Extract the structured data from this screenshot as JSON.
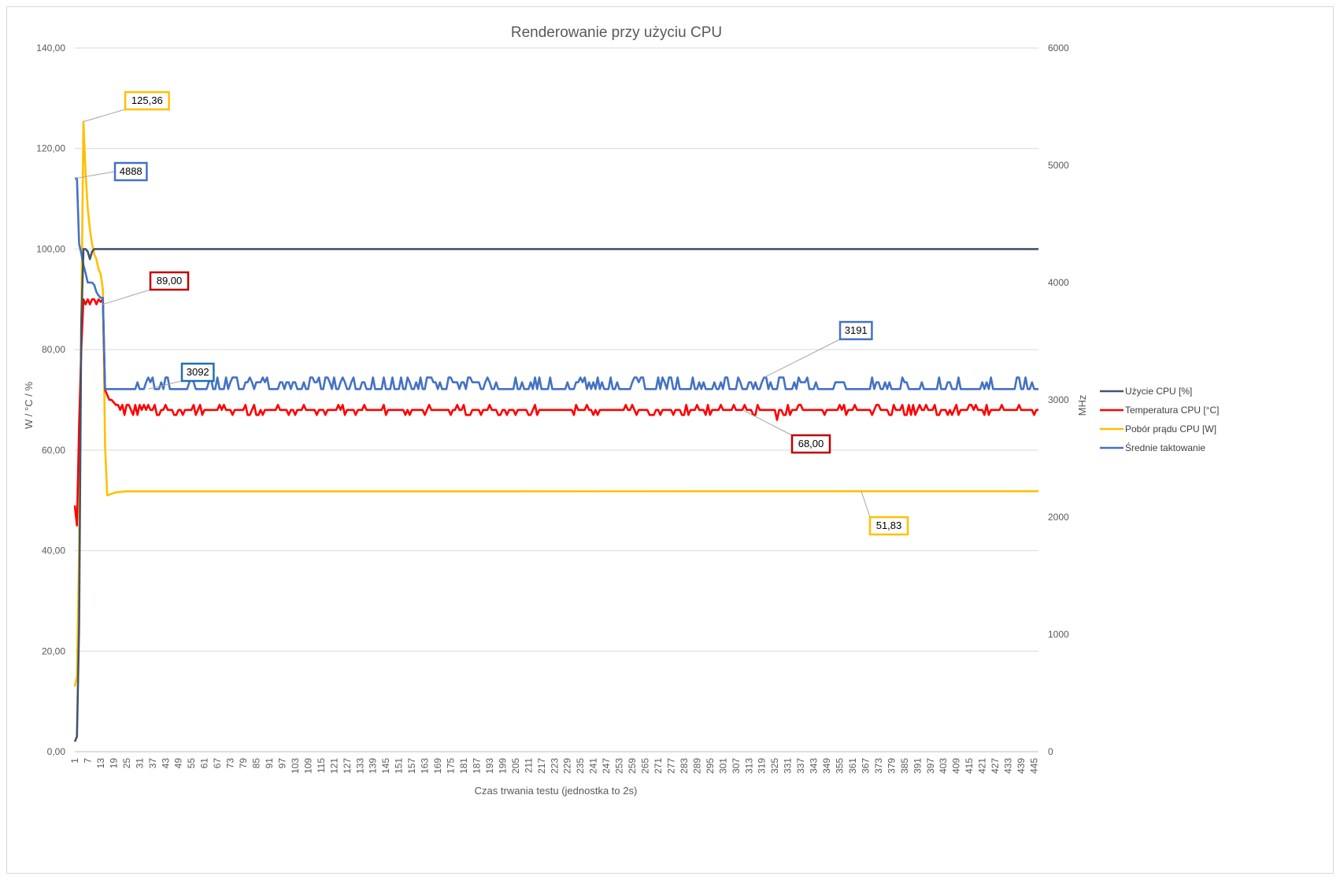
{
  "chart_data": {
    "type": "line",
    "title": "Renderowanie przy użyciu CPU",
    "xlabel": "Czas trwania testu (jednostka to 2s)",
    "ylabel_left": "W / °C / %",
    "ylabel_right": "MHz",
    "ylim_left": [
      0,
      140
    ],
    "ylim_right": [
      0,
      6000
    ],
    "yticks_left": [
      "0,00",
      "20,00",
      "40,00",
      "60,00",
      "80,00",
      "100,00",
      "120,00",
      "140,00"
    ],
    "yticks_right": [
      "0",
      "1000",
      "2000",
      "3000",
      "4000",
      "5000",
      "6000"
    ],
    "x_range": [
      1,
      447
    ],
    "x_tick_start": 1,
    "x_tick_step": 6,
    "x_tick_end": 445,
    "grid": true,
    "legend_position": "right",
    "series": [
      {
        "name": "Użycie CPU [%]",
        "color": "#44546a",
        "axis": "left",
        "pattern": "usage",
        "points": [
          [
            1,
            2
          ],
          [
            2,
            3
          ],
          [
            3,
            25
          ],
          [
            4,
            85
          ],
          [
            5,
            100
          ],
          [
            6,
            100
          ],
          [
            7,
            99.5
          ],
          [
            8,
            98
          ],
          [
            9,
            99.5
          ],
          [
            10,
            100
          ],
          [
            447,
            100
          ]
        ]
      },
      {
        "name": "Temperatura CPU [°C]",
        "color": "#ff0000",
        "axis": "left",
        "pattern": "temp",
        "points": [
          [
            1,
            49
          ],
          [
            2,
            45
          ],
          [
            3,
            65
          ],
          [
            4,
            80
          ],
          [
            5,
            90
          ],
          [
            6,
            89
          ],
          [
            7,
            90
          ],
          [
            8,
            89
          ],
          [
            9,
            90
          ],
          [
            10,
            90
          ],
          [
            11,
            89
          ],
          [
            12,
            90
          ],
          [
            13,
            89.5
          ],
          [
            14,
            90
          ],
          [
            15,
            72
          ],
          [
            16,
            71
          ],
          [
            17,
            70
          ],
          [
            18,
            70
          ],
          [
            20,
            69
          ],
          [
            30,
            69
          ],
          [
            447,
            68
          ]
        ]
      },
      {
        "name": "Pobór prądu CPU [W]",
        "color": "#ffc000",
        "axis": "left",
        "pattern": "power",
        "points": [
          [
            1,
            13
          ],
          [
            2,
            15
          ],
          [
            3,
            40
          ],
          [
            4,
            85
          ],
          [
            5,
            125.36
          ],
          [
            6,
            115
          ],
          [
            7,
            108
          ],
          [
            8,
            104
          ],
          [
            9,
            101
          ],
          [
            10,
            99
          ],
          [
            11,
            98
          ],
          [
            12,
            96
          ],
          [
            13,
            95
          ],
          [
            14,
            92
          ],
          [
            15,
            61
          ],
          [
            16,
            51
          ],
          [
            18,
            51.3
          ],
          [
            20,
            51.6
          ],
          [
            25,
            51.8
          ],
          [
            447,
            51.83
          ]
        ]
      },
      {
        "name": "Średnie taktowanie",
        "color": "#4472c4",
        "axis": "right",
        "pattern": "clock",
        "points": [
          [
            1,
            4888
          ],
          [
            2,
            4888
          ],
          [
            3,
            4330
          ],
          [
            4,
            4250
          ],
          [
            5,
            4150
          ],
          [
            6,
            4080
          ],
          [
            7,
            4000
          ],
          [
            8,
            4000
          ],
          [
            9,
            4000
          ],
          [
            10,
            3980
          ],
          [
            11,
            3920
          ],
          [
            12,
            3890
          ],
          [
            13,
            3870
          ],
          [
            14,
            3870
          ],
          [
            15,
            3092
          ],
          [
            447,
            3092
          ]
        ]
      }
    ],
    "callouts": [
      {
        "text": "125,36",
        "color": "#ffc000",
        "anchor_x": 5,
        "anchor_y": 125.36,
        "axis": "left"
      },
      {
        "text": "4888",
        "color": "#4472c4",
        "anchor_x": 1,
        "anchor_y": 4888,
        "axis": "right"
      },
      {
        "text": "89,00",
        "color": "#c00000",
        "anchor_x": 14,
        "anchor_y": 89,
        "axis": "left"
      },
      {
        "text": "3092",
        "color": "#1f6fb2",
        "anchor_x": 35,
        "anchor_y": 3092,
        "axis": "right"
      },
      {
        "text": "3191",
        "color": "#4472c4",
        "anchor_x": 320,
        "anchor_y": 3191,
        "axis": "right"
      },
      {
        "text": "68,00",
        "color": "#c00000",
        "anchor_x": 310,
        "anchor_y": 68,
        "axis": "left"
      },
      {
        "text": "51,83",
        "color": "#ffc000",
        "anchor_x": 365,
        "anchor_y": 51.83,
        "axis": "left"
      }
    ]
  }
}
